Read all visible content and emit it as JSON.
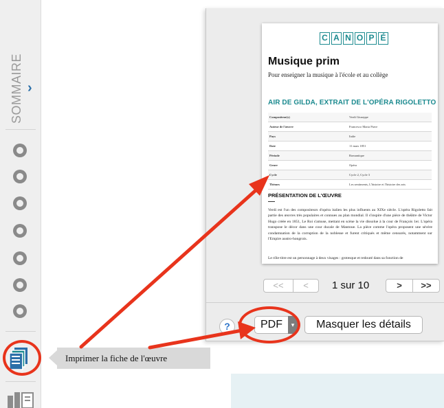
{
  "sidebar": {
    "title": "SOMMAIRE",
    "toggle_icon": "chevron-right-icon",
    "toggle_glyph": "›",
    "radio_count": 7,
    "print_icon": "print-document-icon",
    "library_icon": "library-icon"
  },
  "tooltip": {
    "text": "Imprimer la fiche de l'œuvre"
  },
  "preview": {
    "logo_letters": [
      "C",
      "A",
      "N",
      "O",
      "P",
      "É"
    ],
    "title": "Musique prim",
    "subtitle": "Pour enseigner la musique à l'école et au collège",
    "work_title": "AIR DE GILDA, EXTRAIT DE L'OPÉRA RIGOLETTO",
    "details": [
      {
        "key": "Compositeur(s)",
        "value": "Verdi Giuseppe"
      },
      {
        "key": "Auteur de l'œuvre",
        "value": "Francesco Maria Piave"
      },
      {
        "key": "Pays",
        "value": "Italie"
      },
      {
        "key": "Date",
        "value": "11 mars 1851"
      },
      {
        "key": "Période",
        "value": "Romantique"
      },
      {
        "key": "Genre",
        "value": "Opéra"
      },
      {
        "key": "Cycle",
        "value": "Cycle 2, Cycle 3"
      },
      {
        "key": "Thèmes",
        "value": "Les sentiments, L'histoire et l'histoire des arts"
      }
    ],
    "section_title": "PRÉSENTATION DE L'ŒUVRE",
    "paragraph": "Verdi est l'un des compositeurs d'opéra italien les plus influents au XIXe siècle. L'opéra Rigoletto fait partie des œuvres très populaires et connues au plan mondial. Il s'inspire d'une pièce de théâtre de Victor Hugo créée en 1851, Le Roi s'amuse, mettant en scène la vie dissolue à la cour de François 1er. L'opéra transpose le décor dans une cour ducale de Mantoue. La pièce comme l'opéra proposent une sévère condamnation de la corruption de la noblesse et furent critiqués et même censurés, notamment sur l'Empire austro-hongrois.",
    "paragraph_cut": "Le rôle-titre est un personnage à deux visages : grotesque et redouté dans sa fonction de"
  },
  "pagination": {
    "first_label": "<<",
    "prev_label": "<",
    "indicator": "1 sur 10",
    "next_label": ">",
    "last_label": ">>"
  },
  "controls": {
    "help_label": "?",
    "pdf_label": "PDF",
    "pdf_menu_glyph": "▾",
    "details_label": "Masquer les détails"
  },
  "colors": {
    "accent": "#1b8a8f",
    "highlight": "#e8341c",
    "dialog_bg": "#ececec",
    "sidebar_bg": "#efefef"
  }
}
